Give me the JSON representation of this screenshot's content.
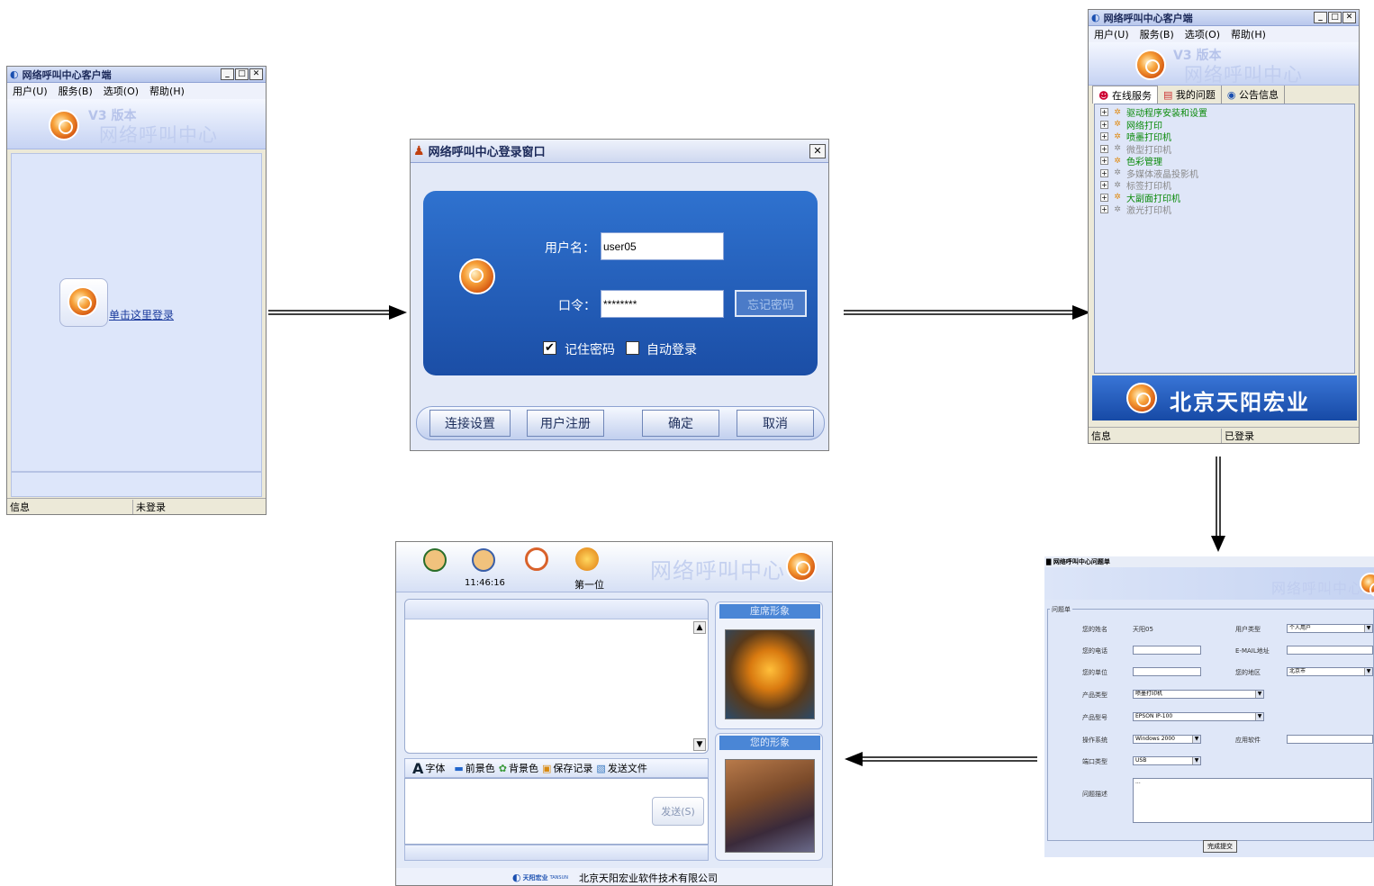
{
  "client_window": {
    "title": "网络呼叫中心客户端",
    "menu": [
      "用户(U)",
      "服务(B)",
      "选项(O)",
      "帮助(H)"
    ],
    "version": "V3 版本",
    "brand": "网络呼叫中心",
    "login_link": "单击这里登录",
    "status_left": "信息",
    "status_right": "未登录"
  },
  "login_window": {
    "title": "网络呼叫中心登录窗口",
    "username_label": "用户名：",
    "username_value": "user05",
    "password_label": "口令：",
    "password_value": "********",
    "forgot_button": "忘记密码",
    "remember_label": "记住密码",
    "remember_checked": true,
    "autologin_label": "自动登录",
    "autologin_checked": false,
    "buttons": [
      "连接设置",
      "用户注册",
      "确定",
      "取消"
    ]
  },
  "logged_window": {
    "title": "网络呼叫中心客户端",
    "menu": [
      "用户(U)",
      "服务(B)",
      "选项(O)",
      "帮助(H)"
    ],
    "version": "V3 版本",
    "brand": "网络呼叫中心",
    "tabs": [
      "在线服务",
      "我的问题",
      "公告信息"
    ],
    "tree": [
      {
        "label": "驱动程序安装和设置",
        "online": true
      },
      {
        "label": "网络打印",
        "online": true
      },
      {
        "label": "喷墨打印机",
        "online": true
      },
      {
        "label": "微型打印机",
        "online": false
      },
      {
        "label": "色彩管理",
        "online": true
      },
      {
        "label": "多媒体液晶投影机",
        "online": false
      },
      {
        "label": "标签打印机",
        "online": false
      },
      {
        "label": "大副面打印机",
        "online": true
      },
      {
        "label": "激光打印机",
        "online": false
      }
    ],
    "company_banner": "北京天阳宏业",
    "status_left": "信息",
    "status_right": "已登录"
  },
  "form_window": {
    "title": "网络呼叫中心问题单",
    "brand": "网络呼叫中心",
    "section": "问题单",
    "fields": {
      "name_label": "您的姓名",
      "name_value": "天阳05",
      "usertype_label": "用户类型",
      "usertype_value": "个人用户",
      "phone_label": "您的电话",
      "email_label": "E-MAIL地址",
      "unit_label": "您的单位",
      "region_label": "您的地区",
      "region_value": "北京市",
      "prodtype_label": "产品类型",
      "prodtype_value": "喷墨打印机",
      "model_label": "产品型号",
      "model_value": "EPSON IP-100",
      "os_label": "操作系统",
      "os_value": "Windows 2000",
      "app_label": "应用软件",
      "port_label": "端口类型",
      "port_value": "USB",
      "desc_label": "问题描述",
      "desc_value": "..."
    },
    "submit": "完成提交"
  },
  "chat_window": {
    "time": "11:46:16",
    "queue": "第一位",
    "brand": "网络呼叫中心",
    "agent_image_label": "座席形象",
    "your_image_label": "您的形象",
    "toolbar": [
      "字体",
      "前景色",
      "背景色",
      "保存记录",
      "发送文件"
    ],
    "send_button": "发送(S)",
    "footer_logo": "天阳宏业",
    "footer_logo_sub": "TANSUN",
    "footer_company": "北京天阳宏业软件技术有限公司"
  },
  "colors": {
    "login_panel": "#2059b4",
    "online_item": "#0a8a0a",
    "offline_item": "#8a8a8a",
    "banner_blue": "#1a4fb0"
  }
}
